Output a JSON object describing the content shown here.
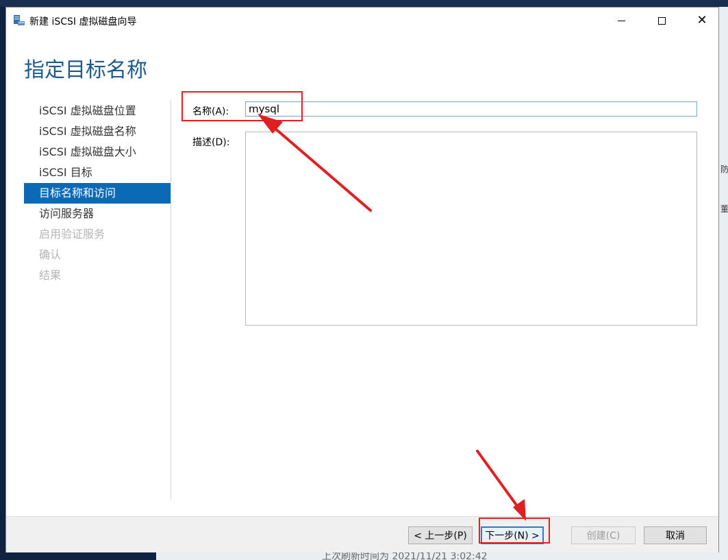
{
  "window": {
    "title": "新建 iSCSI 虚拟磁盘向导",
    "minimize_symbol": "",
    "close_symbol": "✕"
  },
  "page": {
    "title": "指定目标名称"
  },
  "nav": {
    "items": [
      {
        "label": "iSCSI 虚拟磁盘位置",
        "state": "normal"
      },
      {
        "label": "iSCSI 虚拟磁盘名称",
        "state": "normal"
      },
      {
        "label": "iSCSI 虚拟磁盘大小",
        "state": "normal"
      },
      {
        "label": "iSCSI 目标",
        "state": "normal"
      },
      {
        "label": "目标名称和访问",
        "state": "active"
      },
      {
        "label": "访问服务器",
        "state": "normal"
      },
      {
        "label": "启用验证服务",
        "state": "disabled"
      },
      {
        "label": "确认",
        "state": "disabled"
      },
      {
        "label": "结果",
        "state": "disabled"
      }
    ]
  },
  "form": {
    "name_label": "名称(A):",
    "name_value": "mysql",
    "description_label": "描述(D):",
    "description_value": ""
  },
  "buttons": {
    "previous": "< 上一步(P)",
    "next": "下一步(N) >",
    "create": "创建(C)",
    "cancel": "取消"
  },
  "background": {
    "status_text": "上次刷新时间为 2021/11/21 3:02:42",
    "right_frag_1": "防",
    "right_frag_2": "董"
  },
  "colors": {
    "accent": "#0a6ab5",
    "title_blue": "#1c5a8e",
    "annotation_red": "#e02020"
  },
  "icons": {
    "app": "server-icon",
    "minimize": "minimize-icon",
    "maximize": "maximize-icon",
    "close": "close-icon"
  }
}
